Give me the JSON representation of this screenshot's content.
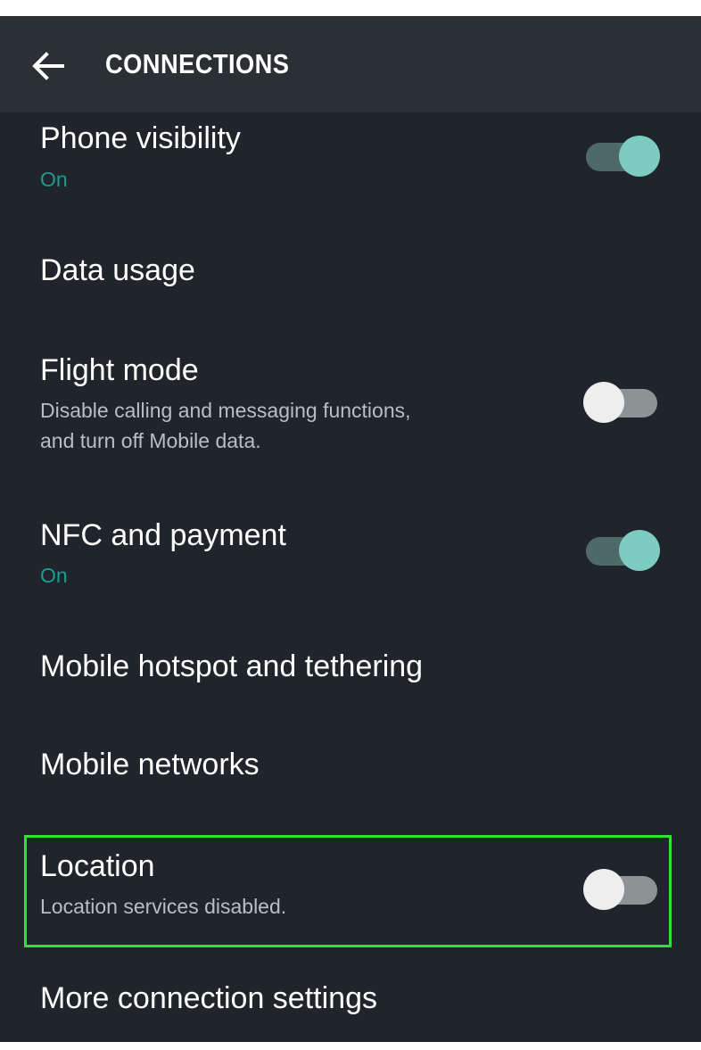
{
  "header": {
    "title": "CONNECTIONS",
    "back_icon": "arrow-left-icon"
  },
  "colors": {
    "background": "#1f252a",
    "app_bar": "#2a3034",
    "accent_teal": "#1e9c92",
    "toggle_on_thumb": "#7cccc2",
    "highlight_green": "#2ee52e"
  },
  "settings": {
    "phone_visibility": {
      "title": "Phone visibility",
      "status": "On",
      "toggle": "on"
    },
    "data_usage": {
      "title": "Data usage"
    },
    "flight_mode": {
      "title": "Flight mode",
      "description": "Disable calling and messaging functions,\nand turn off Mobile data.",
      "toggle": "off"
    },
    "nfc_payment": {
      "title": "NFC and payment",
      "status": "On",
      "toggle": "on"
    },
    "mobile_hotspot": {
      "title": "Mobile hotspot and tethering"
    },
    "mobile_networks": {
      "title": "Mobile networks"
    },
    "location": {
      "title": "Location",
      "description": "Location services disabled.",
      "toggle": "off"
    },
    "more_connection": {
      "title": "More connection settings"
    }
  }
}
